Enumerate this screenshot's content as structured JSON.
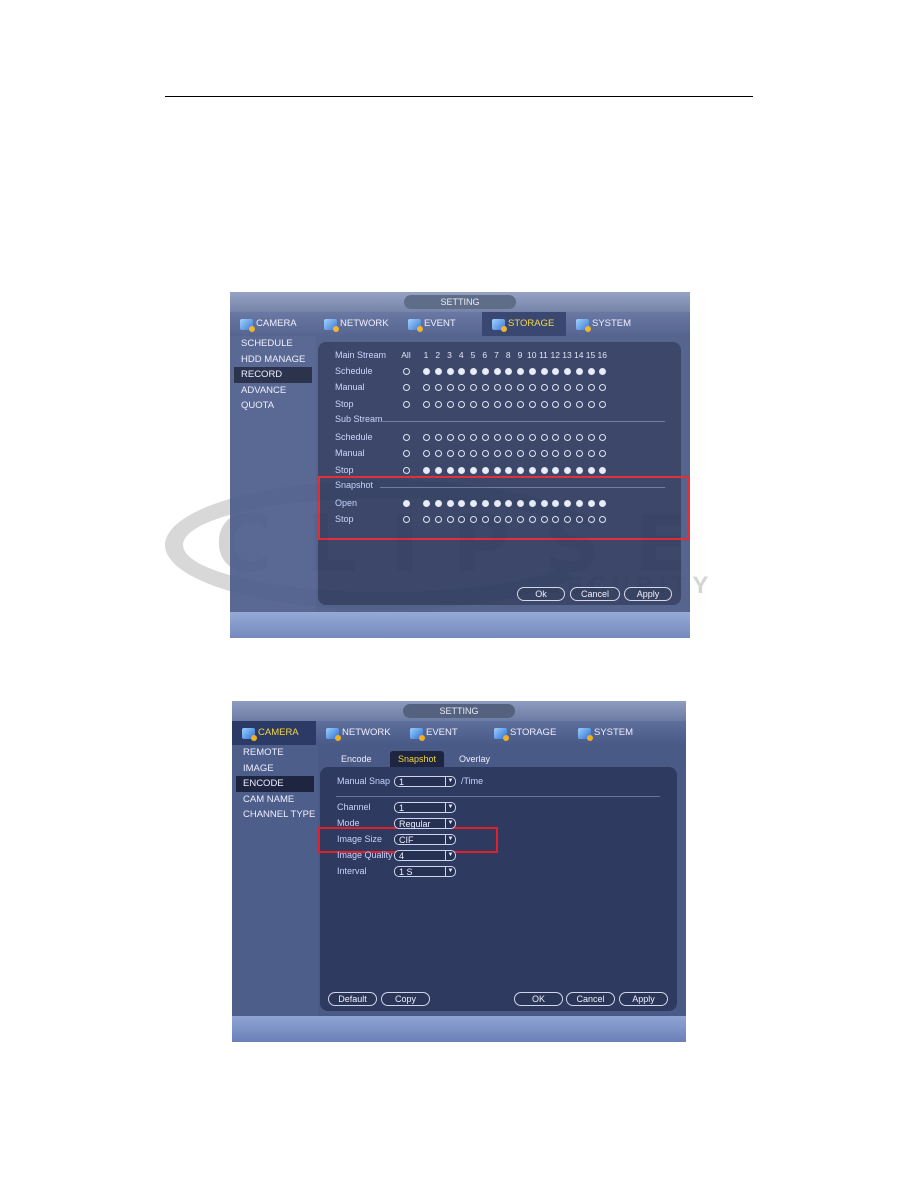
{
  "watermark": {
    "logo": "ECLIPSE SECURITY",
    "word1": "CLIPSE",
    "word2": "SECURITY",
    "reg": "®"
  },
  "shot1": {
    "title": "SETTING",
    "tabs": [
      {
        "label": "CAMERA"
      },
      {
        "label": "NETWORK"
      },
      {
        "label": "EVENT"
      },
      {
        "label": "STORAGE",
        "active": true
      },
      {
        "label": "SYSTEM"
      }
    ],
    "sidebar": [
      {
        "label": "SCHEDULE"
      },
      {
        "label": "HDD MANAGE"
      },
      {
        "label": "RECORD",
        "active": true
      },
      {
        "label": "ADVANCE"
      },
      {
        "label": "QUOTA"
      }
    ],
    "header": {
      "section": "Main Stream",
      "all": "All",
      "channels": [
        "1",
        "2",
        "3",
        "4",
        "5",
        "6",
        "7",
        "8",
        "9",
        "10",
        "11",
        "12",
        "13",
        "14",
        "15",
        "16"
      ]
    },
    "sections": [
      {
        "title": "",
        "rows": [
          {
            "label": "Schedule",
            "all": false,
            "ch": true
          },
          {
            "label": "Manual",
            "all": false,
            "ch": false
          },
          {
            "label": "Stop",
            "all": false,
            "ch": false
          }
        ]
      },
      {
        "title": "Sub Stream",
        "rows": [
          {
            "label": "Schedule",
            "all": false,
            "ch": false
          },
          {
            "label": "Manual",
            "all": false,
            "ch": false
          },
          {
            "label": "Stop",
            "all": false,
            "ch": true
          }
        ]
      },
      {
        "title": "Snapshot",
        "rows": [
          {
            "label": "Open",
            "all": true,
            "ch": true
          },
          {
            "label": "Stop",
            "all": false,
            "ch": false
          }
        ]
      }
    ],
    "buttons": {
      "ok": "Ok",
      "cancel": "Cancel",
      "apply": "Apply"
    },
    "highlight_color": "#e0202a"
  },
  "shot2": {
    "title": "SETTING",
    "tabs": [
      {
        "label": "CAMERA",
        "active": true
      },
      {
        "label": "NETWORK"
      },
      {
        "label": "EVENT"
      },
      {
        "label": "STORAGE"
      },
      {
        "label": "SYSTEM"
      }
    ],
    "sidebar": [
      {
        "label": "REMOTE"
      },
      {
        "label": "IMAGE"
      },
      {
        "label": "ENCODE",
        "active": true
      },
      {
        "label": "CAM NAME"
      },
      {
        "label": "CHANNEL TYPE"
      }
    ],
    "subtabs": [
      {
        "label": "Encode"
      },
      {
        "label": "Snapshot",
        "active": true
      },
      {
        "label": "Overlay"
      }
    ],
    "manual_snap": {
      "label": "Manual Snap",
      "value": "1",
      "unit": "/Time"
    },
    "fields": [
      {
        "label": "Channel",
        "value": "1"
      },
      {
        "label": "Mode",
        "value": "Regular"
      },
      {
        "label": "Image Size",
        "value": "CIF"
      },
      {
        "label": "Image Quality",
        "value": "4"
      },
      {
        "label": "Interval",
        "value": "1 S"
      }
    ],
    "buttons": {
      "default": "Default",
      "copy": "Copy",
      "ok": "OK",
      "cancel": "Cancel",
      "apply": "Apply"
    }
  }
}
